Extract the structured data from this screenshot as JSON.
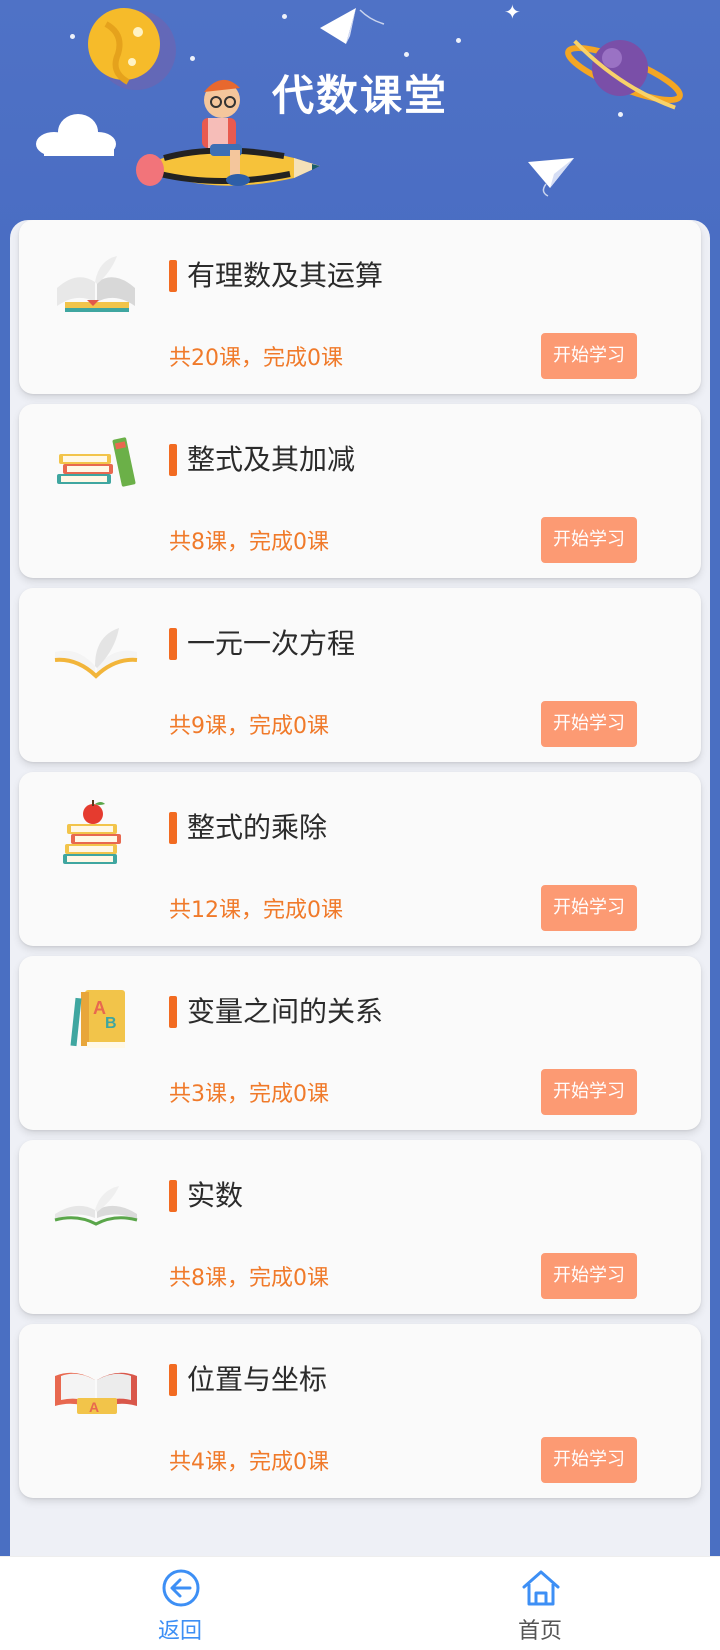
{
  "header": {
    "title": "代数课堂"
  },
  "lessons": [
    {
      "title": "有理数及其运算",
      "count": "共20课，完成0课",
      "button": "开始学习",
      "icon": "open-book-icon"
    },
    {
      "title": "整式及其加减",
      "count": "共8课，完成0课",
      "button": "开始学习",
      "icon": "book-stack-icon"
    },
    {
      "title": "一元一次方程",
      "count": "共9课，完成0课",
      "button": "开始学习",
      "icon": "open-book-icon"
    },
    {
      "title": "整式的乘除",
      "count": "共12课，完成0课",
      "button": "开始学习",
      "icon": "books-with-apple-icon"
    },
    {
      "title": "变量之间的关系",
      "count": "共3课，完成0课",
      "button": "开始学习",
      "icon": "alphabet-book-icon"
    },
    {
      "title": "实数",
      "count": "共8课，完成0课",
      "button": "开始学习",
      "icon": "open-book-icon"
    },
    {
      "title": "位置与坐标",
      "count": "共4课，完成0课",
      "button": "开始学习",
      "icon": "red-book-icon"
    }
  ],
  "nav": {
    "back_label": "返回",
    "home_label": "首页"
  },
  "colors": {
    "header_bg": "#4f72c6",
    "accent_orange": "#f26b21",
    "count_text": "#f07a2a",
    "button_bg": "#fc9a73",
    "nav_active": "#3d8ff5"
  }
}
